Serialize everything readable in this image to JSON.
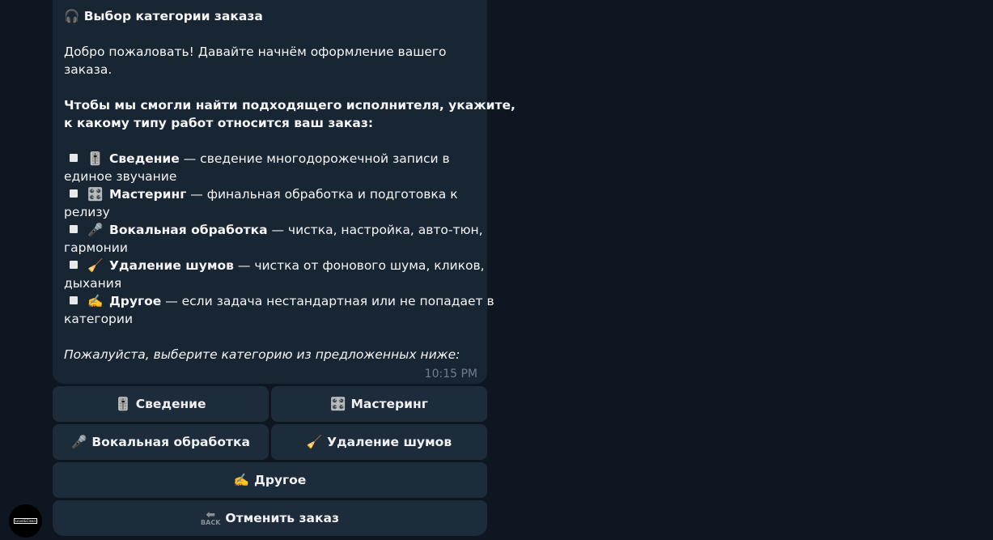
{
  "avatar": {
    "label": "Level&Clean"
  },
  "message": {
    "title": "🎧 Выбор категории заказа",
    "welcome_1": "Добро пожаловать! Давайте начнём оформление вашего",
    "welcome_2": "заказа.",
    "prompt_1": "Чтобы мы смогли найти подходящего исполнителя, укажите,",
    "prompt_2": "к какому типу работ относится ваш заказ:",
    "items": [
      {
        "emoji": "🎚️",
        "name": "Сведение",
        "desc": " — сведение многодорожечной записи в",
        "desc2": "единое звучание"
      },
      {
        "emoji": "🎛️",
        "name": "Мастеринг",
        "desc": " — финальная обработка и подготовка к",
        "desc2": "релизу"
      },
      {
        "emoji": "🎤",
        "name": "Вокальная обработка",
        "desc": " — чистка, настройка, авто-тюн,",
        "desc2": "гармонии"
      },
      {
        "emoji": "🧹",
        "name": "Удаление шумов",
        "desc": " — чистка от фонового шума, кликов,",
        "desc2": "дыхания"
      },
      {
        "emoji": "✍️",
        "name": "Другое",
        "desc": " — если задача нестандартная или не попадает в",
        "desc2": "категории"
      }
    ],
    "footer": "Пожалуйста, выберите категорию из предложенных ниже:",
    "time": "10:15 PM"
  },
  "keyboard": {
    "mixing": {
      "icon": "🎚️",
      "label": "Сведение"
    },
    "mastering": {
      "icon": "🎛️",
      "label": "Мастеринг"
    },
    "vocal": {
      "icon": "🎤",
      "label": "Вокальная обработка"
    },
    "noise": {
      "icon": "🧹",
      "label": "Удаление шумов"
    },
    "other": {
      "icon": "✍️",
      "label": "Другое"
    },
    "cancel": {
      "icon_text": "BACK",
      "label": "Отменить заказ"
    }
  }
}
